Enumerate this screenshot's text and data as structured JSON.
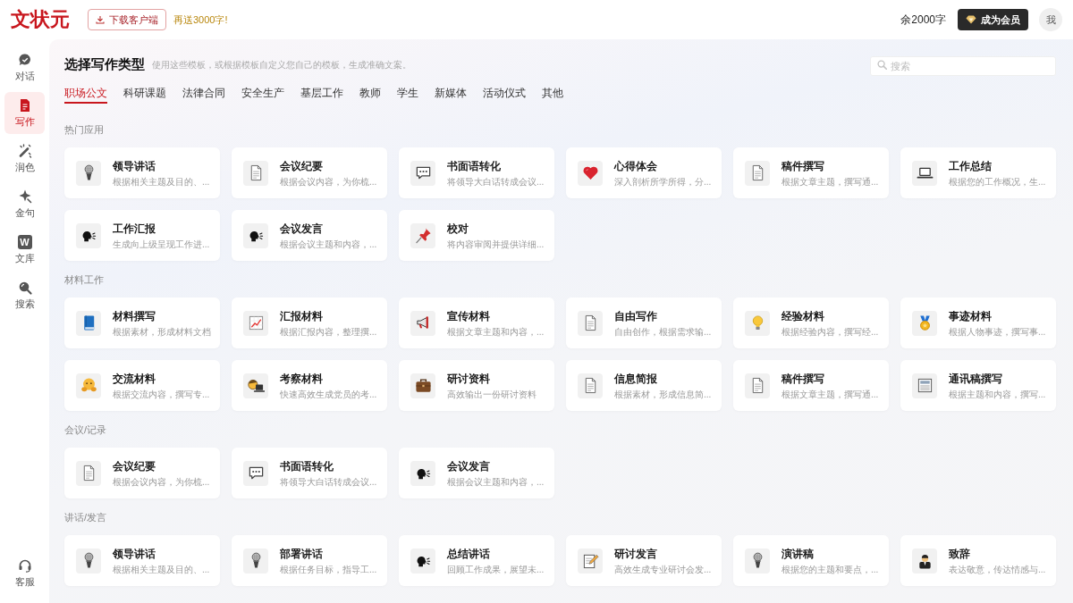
{
  "header": {
    "logo": "文状元",
    "download_button": "下载客户端",
    "promo": "再送3000字!",
    "quota": "余2000字",
    "vip_button": "成为会员",
    "avatar": "我"
  },
  "sidebar": {
    "items": [
      {
        "label": "对话",
        "kind": "chat",
        "selected": false
      },
      {
        "label": "写作",
        "kind": "write",
        "selected": true
      },
      {
        "label": "润色",
        "kind": "wand",
        "selected": false
      },
      {
        "label": "金句",
        "kind": "sparkle",
        "selected": false
      },
      {
        "label": "文库",
        "kind": "library",
        "badge": "W",
        "selected": false
      },
      {
        "label": "搜索",
        "kind": "search",
        "selected": false
      }
    ],
    "footer_item": {
      "label": "客服",
      "kind": "headset"
    }
  },
  "page": {
    "title": "选择写作类型",
    "subtitle": "使用这些模板，或根据模板自定义您自己的模板，生成准确文案。",
    "search": {
      "placeholder": "搜索"
    }
  },
  "tabs": [
    {
      "label": "职场公文",
      "selected": true
    },
    {
      "label": "科研课题",
      "selected": false
    },
    {
      "label": "法律合同",
      "selected": false
    },
    {
      "label": "安全生产",
      "selected": false
    },
    {
      "label": "基层工作",
      "selected": false
    },
    {
      "label": "教师",
      "selected": false
    },
    {
      "label": "学生",
      "selected": false
    },
    {
      "label": "新媒体",
      "selected": false
    },
    {
      "label": "活动仪式",
      "selected": false
    },
    {
      "label": "其他",
      "selected": false
    }
  ],
  "sections": [
    {
      "title": "热门应用",
      "cards": [
        {
          "title": "领导讲话",
          "description": "根据相关主题及目的、...",
          "kind": "microphone"
        },
        {
          "title": "会议纪要",
          "description": "根据会议内容，为你梳...",
          "kind": "document"
        },
        {
          "title": "书面语转化",
          "description": "将领导大白话转成会议...",
          "kind": "speech"
        },
        {
          "title": "心得体会",
          "description": "深入剖析所学所得，分...",
          "kind": "heart"
        },
        {
          "title": "稿件撰写",
          "description": "根据文章主题，撰写通...",
          "kind": "document"
        },
        {
          "title": "工作总结",
          "description": "根据您的工作概况，生...",
          "kind": "laptop"
        },
        {
          "title": "工作汇报",
          "description": "生成向上级呈现工作进...",
          "kind": "speaker"
        },
        {
          "title": "会议发言",
          "description": "根据会议主题和内容，...",
          "kind": "speaker"
        },
        {
          "title": "校对",
          "description": "将内容审阅并提供详细...",
          "kind": "pin"
        }
      ]
    },
    {
      "title": "材料工作",
      "cards": [
        {
          "title": "材料撰写",
          "description": "根据素材，形成材料文档",
          "kind": "book"
        },
        {
          "title": "汇报材料",
          "description": "根据汇报内容，整理撰...",
          "kind": "chart"
        },
        {
          "title": "宣传材料",
          "description": "根据文章主题和内容，...",
          "kind": "megaphone"
        },
        {
          "title": "自由写作",
          "description": "自由创作，根据需求输...",
          "kind": "document"
        },
        {
          "title": "经验材料",
          "description": "根据经验内容，撰写经...",
          "kind": "bulb"
        },
        {
          "title": "事迹材料",
          "description": "根据人物事迹，撰写事...",
          "kind": "medal"
        },
        {
          "title": "交流材料",
          "description": "根据交流内容，撰写专...",
          "kind": "hug"
        },
        {
          "title": "考察材料",
          "description": "快速高效生成党员的考...",
          "kind": "coder"
        },
        {
          "title": "研讨资料",
          "description": "高效输出一份研讨资料",
          "kind": "briefcase"
        },
        {
          "title": "信息简报",
          "description": "根据素材，形成信息简...",
          "kind": "document"
        },
        {
          "title": "稿件撰写",
          "description": "根据文章主题，撰写通...",
          "kind": "document"
        },
        {
          "title": "通讯稿撰写",
          "description": "根据主题和内容，撰写...",
          "kind": "newspaper"
        }
      ]
    },
    {
      "title": "会议/记录",
      "cards": [
        {
          "title": "会议纪要",
          "description": "根据会议内容，为你梳...",
          "kind": "document"
        },
        {
          "title": "书面语转化",
          "description": "将领导大白话转成会议...",
          "kind": "speech"
        },
        {
          "title": "会议发言",
          "description": "根据会议主题和内容，...",
          "kind": "speaker"
        }
      ]
    },
    {
      "title": "讲话/发言",
      "cards": [
        {
          "title": "领导讲话",
          "description": "根据相关主题及目的、...",
          "kind": "microphone"
        },
        {
          "title": "部署讲话",
          "description": "根据任务目标，指导工...",
          "kind": "microphone"
        },
        {
          "title": "总结讲话",
          "description": "回顾工作成果，展望未...",
          "kind": "speaker"
        },
        {
          "title": "研讨发言",
          "description": "高效生成专业研讨会发...",
          "kind": "memo"
        },
        {
          "title": "演讲稿",
          "description": "根据您的主题和要点，...",
          "kind": "microphone"
        },
        {
          "title": "致辞",
          "description": "表达敬意，传达情感与...",
          "kind": "person"
        }
      ]
    }
  ]
}
